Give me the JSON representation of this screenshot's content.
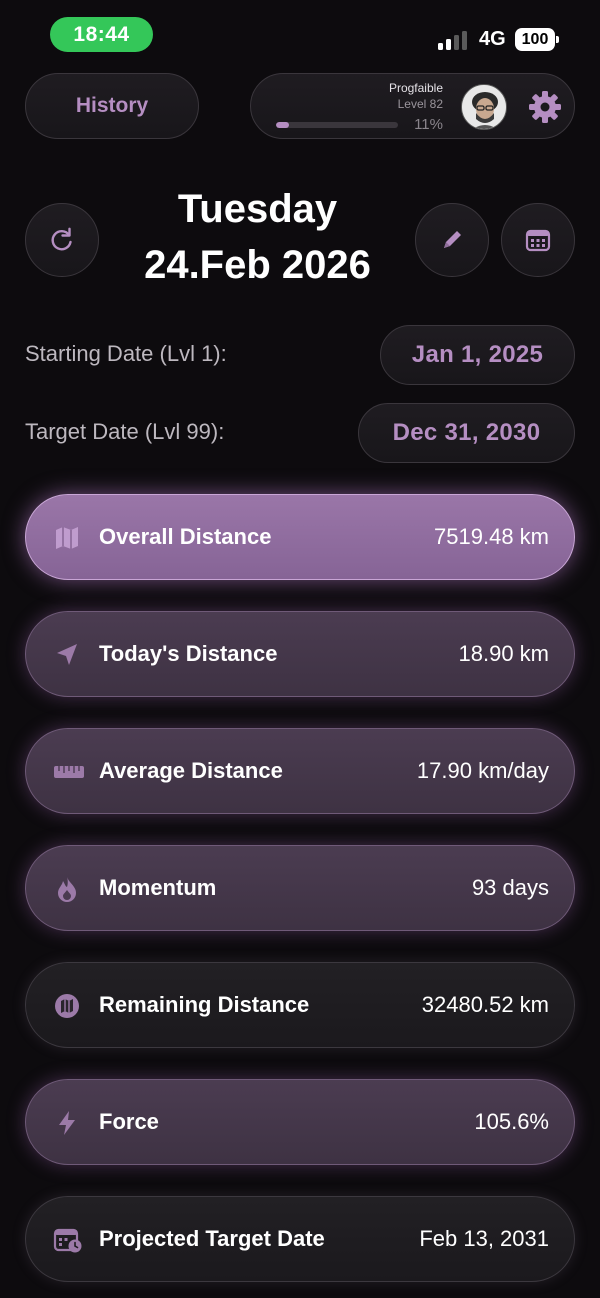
{
  "status_bar": {
    "time": "18:44",
    "network": "4G",
    "battery": "100"
  },
  "header": {
    "history_label": "History",
    "profile": {
      "username": "Progfaible",
      "level": "Level 82",
      "xp_percent": "11%",
      "xp_fraction": 0.11
    }
  },
  "date": {
    "weekday": "Tuesday",
    "full_date": "24.Feb 2026"
  },
  "dates": {
    "starting_label": "Starting Date (Lvl 1):",
    "starting_value": "Jan 1, 2025",
    "target_label": "Target Date (Lvl 99):",
    "target_value": "Dec 31, 2030"
  },
  "stats": [
    {
      "label": "Overall Distance",
      "value": "7519.48 km",
      "icon": "map-icon"
    },
    {
      "label": "Today's Distance",
      "value": "18.90 km",
      "icon": "navigation-arrow-icon"
    },
    {
      "label": "Average Distance",
      "value": "17.90 km/day",
      "icon": "ruler-icon"
    },
    {
      "label": "Momentum",
      "value": "93 days",
      "icon": "flame-icon"
    },
    {
      "label": "Remaining Distance",
      "value": "32480.52 km",
      "icon": "map-circle-icon"
    },
    {
      "label": "Force",
      "value": "105.6%",
      "icon": "bolt-icon"
    },
    {
      "label": "Projected Target Date",
      "value": "Feb 13, 2031",
      "icon": "calendar-clock-icon"
    }
  ],
  "colors": {
    "accent": "#b58ec2",
    "status_green": "#34c759",
    "background": "#0d0b0e"
  }
}
